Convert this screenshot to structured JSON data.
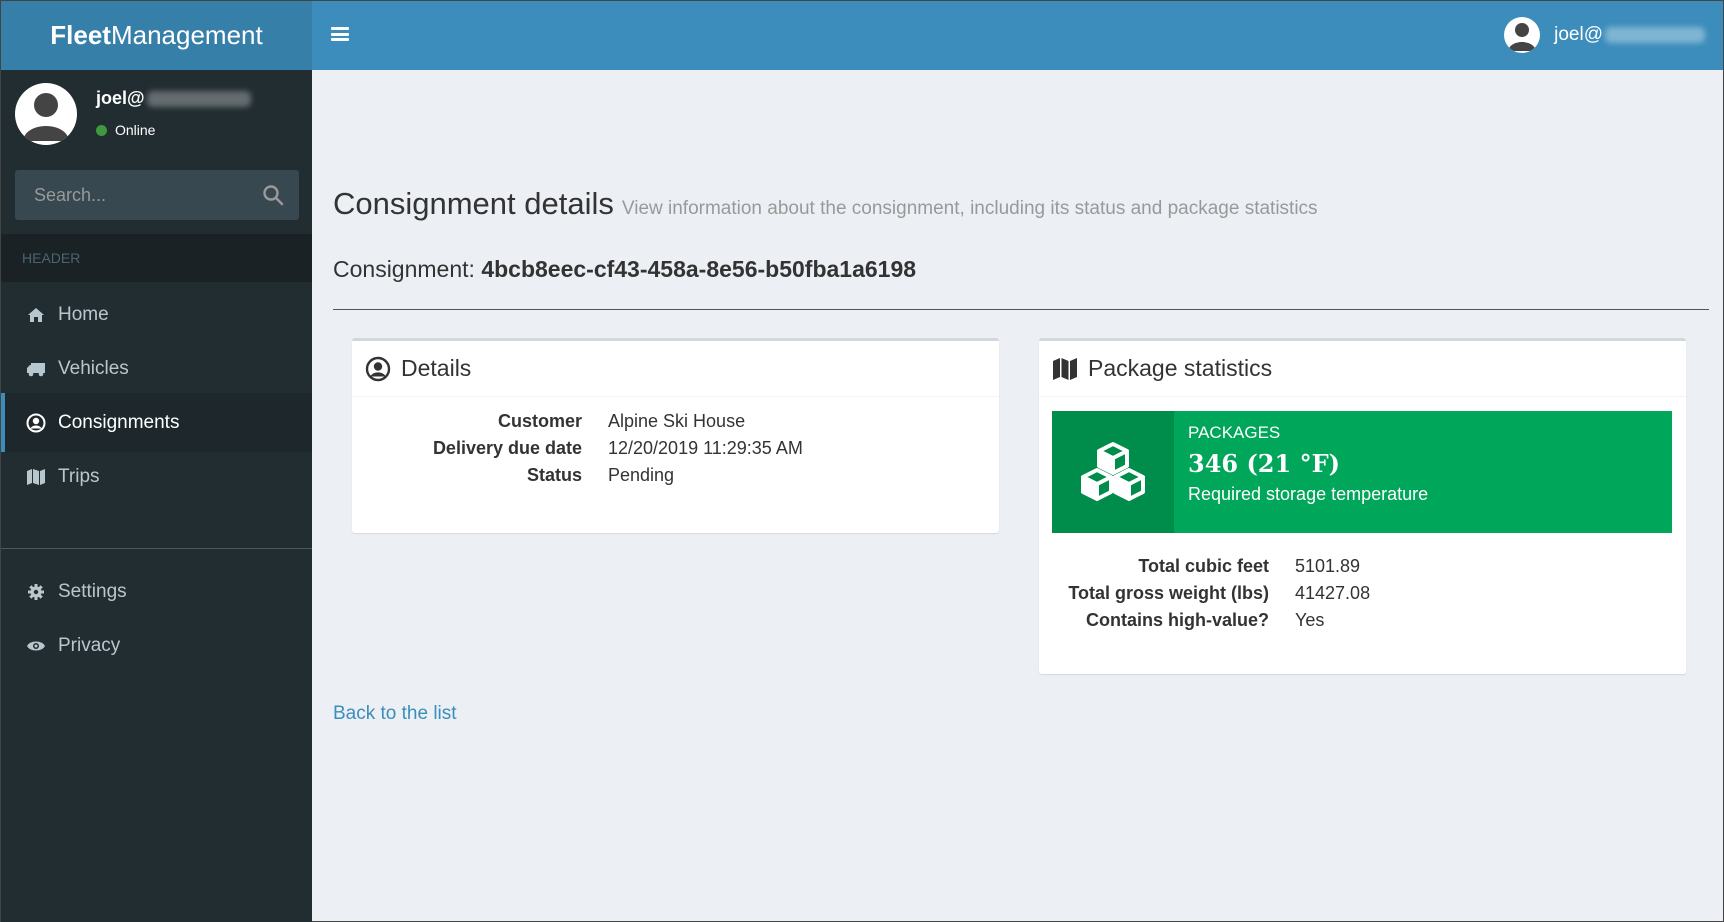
{
  "app": {
    "logo_bold": "Fleet",
    "logo_rest": "Management"
  },
  "header": {
    "user_name": "joel@"
  },
  "sidebar": {
    "user": {
      "name": "joel@",
      "status": "Online"
    },
    "search": {
      "placeholder": "Search..."
    },
    "section_header": "HEADER",
    "items": [
      {
        "label": "Home",
        "icon": "home-icon"
      },
      {
        "label": "Vehicles",
        "icon": "truck-icon"
      },
      {
        "label": "Consignments",
        "icon": "user-circle-icon",
        "active": true
      },
      {
        "label": "Trips",
        "icon": "map-icon"
      },
      {
        "label": "Settings",
        "icon": "gear-icon"
      },
      {
        "label": "Privacy",
        "icon": "eye-icon"
      }
    ]
  },
  "page": {
    "title": "Consignment details",
    "subtitle": "View information about the consignment, including its status and package statistics",
    "consignment_label": "Consignment:",
    "consignment_id": "4bcb8eec-cf43-458a-8e56-b50fba1a6198",
    "back_link": "Back to the list"
  },
  "details": {
    "title": "Details",
    "rows": [
      {
        "label": "Customer",
        "value": "Alpine Ski House"
      },
      {
        "label": "Delivery due date",
        "value": "12/20/2019 11:29:35 AM"
      },
      {
        "label": "Status",
        "value": "Pending"
      }
    ]
  },
  "package_stats": {
    "title": "Package statistics",
    "info": {
      "label": "PACKAGES",
      "number": "346 (21 °F)",
      "desc": "Required storage temperature",
      "color": "#00a65a"
    },
    "rows": [
      {
        "label": "Total cubic feet",
        "value": "5101.89"
      },
      {
        "label": "Total gross weight (lbs)",
        "value": "41427.08"
      },
      {
        "label": "Contains high-value?",
        "value": "Yes"
      }
    ]
  }
}
